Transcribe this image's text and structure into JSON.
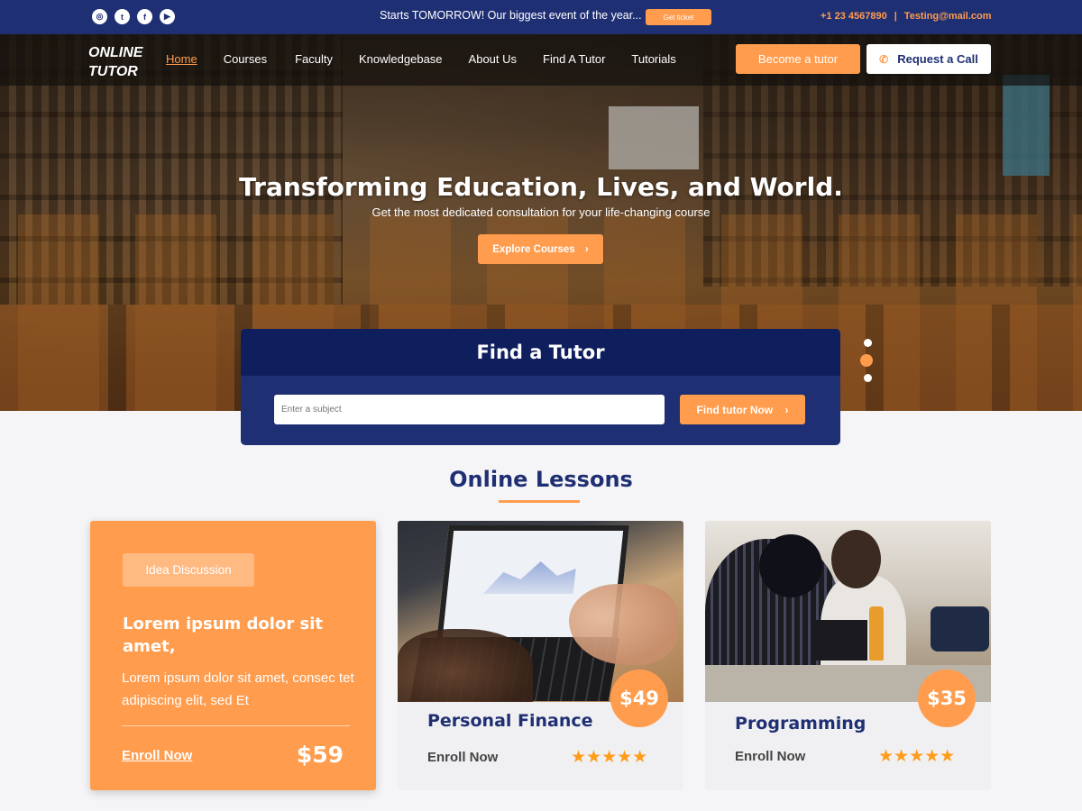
{
  "topbar": {
    "social": [
      {
        "icon": "instagram-icon",
        "glyph": "◎"
      },
      {
        "icon": "twitter-icon",
        "glyph": "t"
      },
      {
        "icon": "facebook-icon",
        "glyph": "f"
      },
      {
        "icon": "youtube-icon",
        "glyph": "▶"
      }
    ],
    "promo": "Starts TOMORROW! Our biggest event of the year...",
    "ticket_label": "Get ticket",
    "phone": "+1 23 4567890",
    "separator": "|",
    "email": "Testing@mail.com"
  },
  "nav": {
    "logo_line1": "ONLINE",
    "logo_line2": "TUTOR",
    "links": [
      {
        "label": "Home",
        "active": true
      },
      {
        "label": "Courses",
        "active": false
      },
      {
        "label": "Faculty",
        "active": false
      },
      {
        "label": "Knowledgebase",
        "active": false
      },
      {
        "label": "About Us",
        "active": false
      },
      {
        "label": "Find A Tutor",
        "active": false
      },
      {
        "label": "Tutorials",
        "active": false
      }
    ],
    "become_tutor": "Become a tutor",
    "request_call": "Request a Call"
  },
  "hero": {
    "title": "Transforming Education, Lives, and World.",
    "subtitle": "Get the most dedicated consultation for your life-changing course",
    "explore": "Explore Courses",
    "slides_total": 3,
    "active_slide": 2
  },
  "find_tutor": {
    "title": "Find a Tutor",
    "placeholder": "Enter a subject",
    "button": "Find tutor Now"
  },
  "lessons": {
    "title": "Online Lessons",
    "featured": {
      "tag": "Idea Discussion",
      "heading": "Lorem ipsum dolor sit amet,",
      "text": "Lorem ipsum dolor sit amet, consec tet adipiscing elit, sed Et",
      "enroll": "Enroll Now",
      "price": "$59"
    },
    "cards": [
      {
        "title": "Personal Finance",
        "price": "$49",
        "enroll": "Enroll Now",
        "rating": 5,
        "stars": "★★★★★"
      },
      {
        "title": "Programming",
        "price": "$35",
        "enroll": "Enroll Now",
        "rating": 5,
        "stars": "★★★★★"
      }
    ]
  },
  "colors": {
    "brand_navy": "#1f2f73",
    "accent_orange": "#ff9c4d",
    "background": "#f5f5f7"
  }
}
